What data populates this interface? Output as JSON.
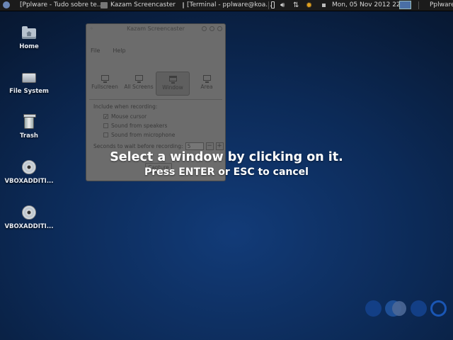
{
  "panel": {
    "tasks": [
      {
        "label": "[Pplware - Tudo sobre te..."
      },
      {
        "label": "Kazam Screencaster"
      },
      {
        "label": "[Terminal - pplware@koa..."
      }
    ],
    "clock": "Mon, 05 Nov 2012 22:11",
    "user": "Pplware"
  },
  "desktop": {
    "icons": [
      {
        "label": "Home",
        "icon": "home-folder-icon"
      },
      {
        "label": "File System",
        "icon": "drive-icon"
      },
      {
        "label": "Trash",
        "icon": "trash-icon"
      },
      {
        "label": "VBOXADDITI...",
        "icon": "cd-disc-icon"
      },
      {
        "label": "VBOXADDITI...",
        "icon": "cd-disc-icon"
      }
    ]
  },
  "kazam": {
    "title": "Kazam Screencaster",
    "menu": [
      "File",
      "Help"
    ],
    "modes": [
      "Fullscreen",
      "All Screens",
      "Window",
      "Area"
    ],
    "selected_mode": "Window",
    "include_label": "Include when recording:",
    "options": [
      {
        "label": "Mouse cursor",
        "checked": true
      },
      {
        "label": "Sound from speakers",
        "checked": false
      },
      {
        "label": "Sound from microphone",
        "checked": false
      }
    ],
    "delay_label": "Seconds to wait before recording:",
    "delay_value": "5",
    "capture_label": "Capture"
  },
  "overlay": {
    "line1": "Select a window by clicking on it.",
    "line2": "Press ENTER or ESC to cancel"
  }
}
